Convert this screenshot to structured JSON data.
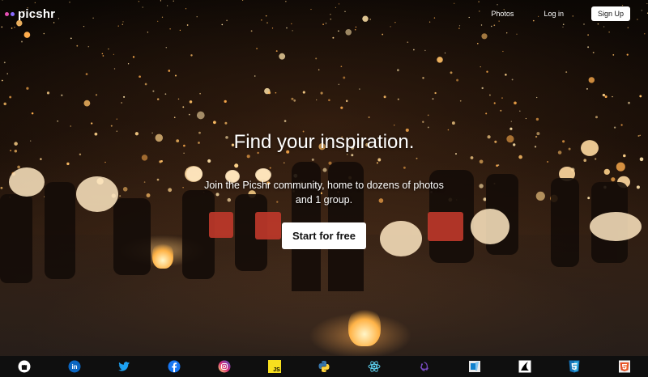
{
  "brand": {
    "name": "picshr",
    "dot_colors": [
      "#e34fb2",
      "#8a6cff"
    ]
  },
  "nav": {
    "photos_label": "Photos",
    "login_label": "Log in",
    "signup_label": "Sign Up"
  },
  "hero": {
    "headline": "Find your inspiration.",
    "subtext": "Join the Picshr community, home to dozens of photos and 1 group.",
    "cta_label": "Start for free"
  },
  "footer": {
    "icons": [
      {
        "name": "github-icon",
        "color": "#ffffff"
      },
      {
        "name": "linkedin-icon",
        "color": "#0a66c2"
      },
      {
        "name": "twitter-icon",
        "color": "#1da1f2"
      },
      {
        "name": "facebook-icon",
        "color": "#1877f2"
      },
      {
        "name": "instagram-icon",
        "color": "#e1306c"
      },
      {
        "name": "javascript-icon",
        "color": "#f7df1e",
        "text": "JS"
      },
      {
        "name": "python-icon",
        "color": "#3776ab"
      },
      {
        "name": "react-icon",
        "color": "#61dafb"
      },
      {
        "name": "redux-icon",
        "color": "#764abc"
      },
      {
        "name": "sqlite-icon",
        "color": "#cccccc"
      },
      {
        "name": "flask-icon",
        "color": "#ffffff"
      },
      {
        "name": "css3-icon",
        "color": "#1572b6"
      },
      {
        "name": "html5-icon",
        "color": "#e34f26"
      }
    ]
  }
}
